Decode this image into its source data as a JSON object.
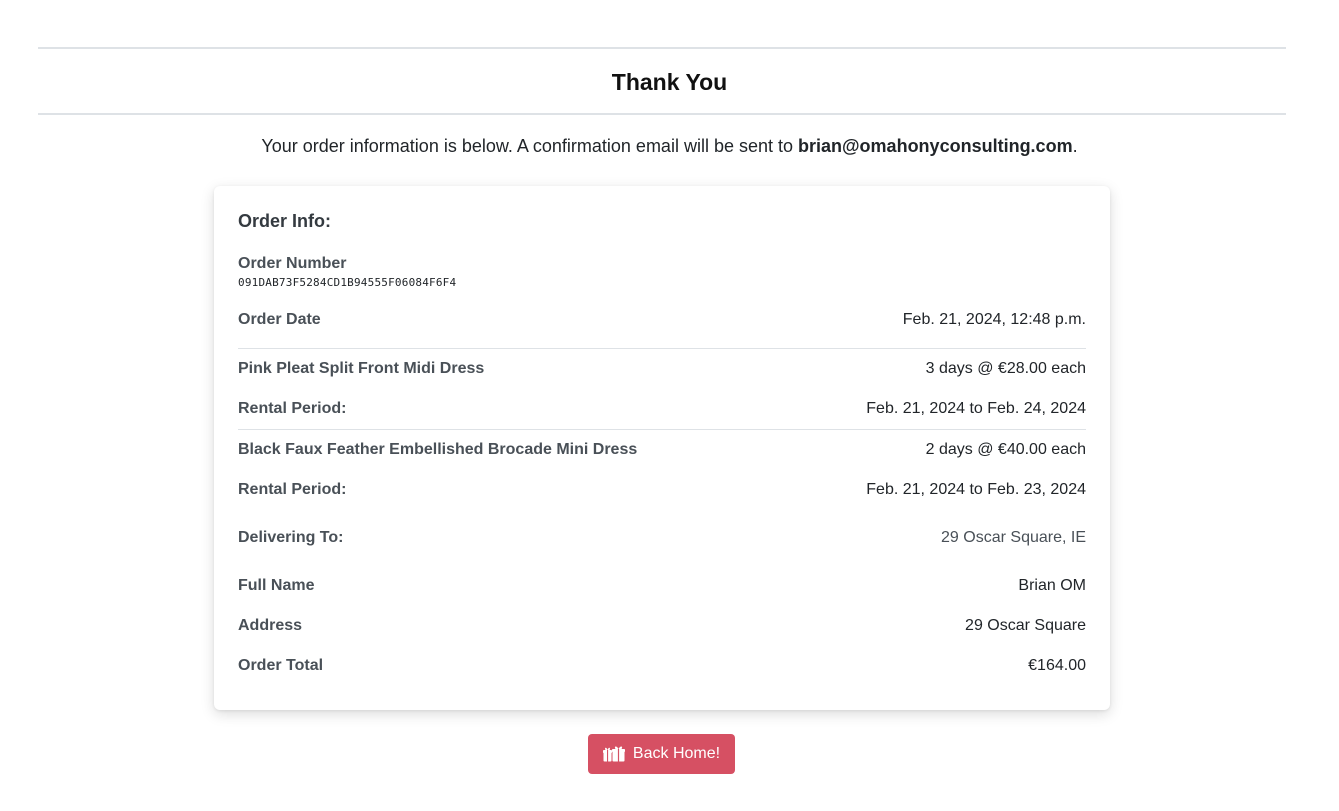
{
  "header": {
    "title": "Thank You",
    "intro_prefix": "Your order information is below. A confirmation email will be sent to ",
    "email": "brian@omahonyconsulting.com",
    "intro_suffix": "."
  },
  "order": {
    "section_title": "Order Info:",
    "number_label": "Order Number",
    "number_value": "091DAB73F5284CD1B94555F06084F6F4",
    "date_label": "Order Date",
    "date_value": "Feb. 21, 2024, 12:48 p.m.",
    "items": [
      {
        "name": "Pink Pleat Split Front Midi Dress",
        "price": "3 days @ €28.00 each",
        "rental_label": "Rental Period:",
        "rental_period": "Feb. 21, 2024 to Feb. 24, 2024"
      },
      {
        "name": "Black Faux Feather Embellished Brocade Mini Dress",
        "price": "2 days @ €40.00 each",
        "rental_label": "Rental Period:",
        "rental_period": "Feb. 21, 2024 to Feb. 23, 2024"
      }
    ],
    "delivering_label": "Delivering To:",
    "delivering_value": "29 Oscar Square, IE",
    "full_name_label": "Full Name",
    "full_name_value": "Brian OM",
    "address_label": "Address",
    "address_value": "29 Oscar Square",
    "total_label": "Order Total",
    "total_value": "€164.00"
  },
  "actions": {
    "back_home_label": "Back Home!",
    "back_home_icon": "gifts-icon"
  },
  "colors": {
    "button_bg": "#d65063",
    "divider": "#dee2e6"
  }
}
